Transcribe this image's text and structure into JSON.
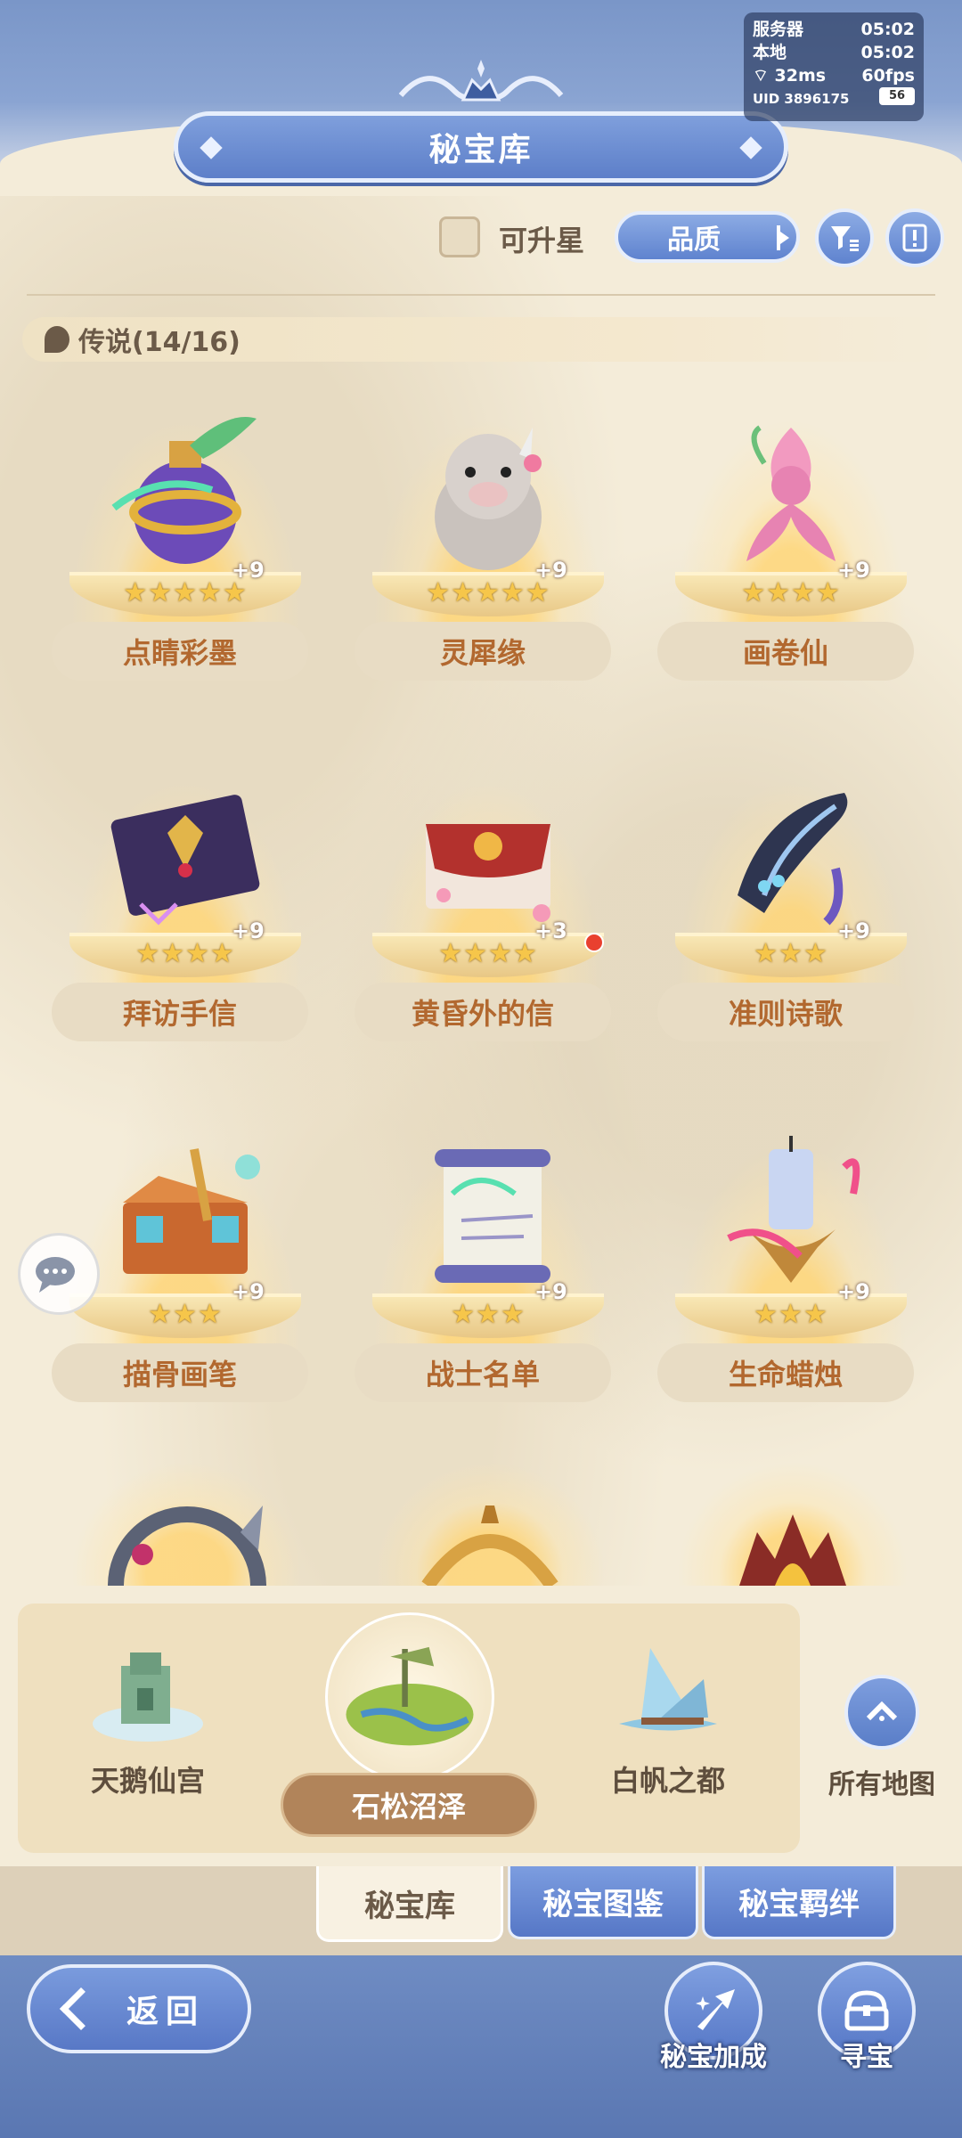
{
  "status": {
    "server_label": "服务器",
    "server_time": "05:02",
    "local_label": "本地",
    "local_time": "05:02",
    "ping": "32ms",
    "fps": "60fps",
    "uid": "UID 3896175",
    "battery": "56"
  },
  "header": {
    "title": "秘宝库"
  },
  "toolbar": {
    "upgradable_label": "可升星",
    "sort_label": "品质",
    "filter_icon": "filter-icon",
    "info_icon": "info-icon"
  },
  "section": {
    "title": "传说(14/16)"
  },
  "items": [
    {
      "name": "点睛彩墨",
      "stars": "★★★★★",
      "plus": "+9",
      "new": false,
      "icon": "ink-potion-icon"
    },
    {
      "name": "灵犀缘",
      "stars": "★★★★★",
      "plus": "+9",
      "new": false,
      "icon": "rhino-plush-icon"
    },
    {
      "name": "画卷仙",
      "stars": "★★★★",
      "plus": "+9",
      "new": false,
      "icon": "flower-fairy-icon"
    },
    {
      "name": "拜访手信",
      "stars": "★★★★",
      "plus": "+9",
      "new": false,
      "icon": "purple-letter-icon"
    },
    {
      "name": "黄昏外的信",
      "stars": "★★★★",
      "plus": "+3",
      "new": true,
      "icon": "red-letter-icon"
    },
    {
      "name": "准则诗歌",
      "stars": "★★★",
      "plus": "+9",
      "new": false,
      "icon": "lyre-icon"
    },
    {
      "name": "描骨画笔",
      "stars": "★★★",
      "plus": "+9",
      "new": false,
      "icon": "paint-box-icon"
    },
    {
      "name": "战士名单",
      "stars": "★★★",
      "plus": "+9",
      "new": false,
      "icon": "scroll-icon"
    },
    {
      "name": "生命蜡烛",
      "stars": "★★★",
      "plus": "+9",
      "new": false,
      "icon": "candle-icon"
    }
  ],
  "maps": {
    "left": "天鹅仙宫",
    "selected": "石松沼泽",
    "right": "白帆之都",
    "all_label": "所有地图"
  },
  "tabs": {
    "active": "秘宝库",
    "atlas": "秘宝图鉴",
    "bonds": "秘宝羁绊"
  },
  "bottom": {
    "back_label": "返回",
    "bonus_label": "秘宝加成",
    "seek_label": "寻宝"
  },
  "colors": {
    "accent_blue": "#5f83cf",
    "name_text": "#b2682f",
    "star_gold": "#f6c64a",
    "new_dot": "#e9402f"
  }
}
